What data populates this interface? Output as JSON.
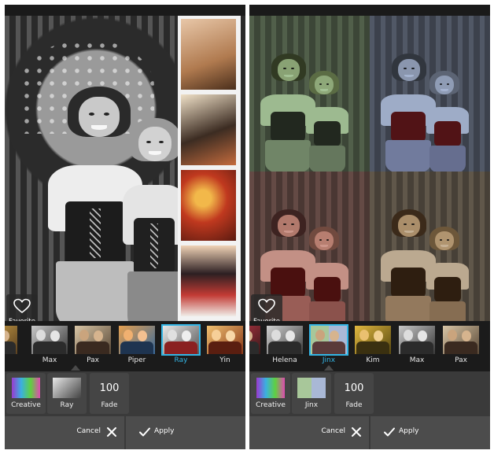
{
  "left": {
    "filters": [
      {
        "label": "m",
        "selected": false
      },
      {
        "label": "Max",
        "selected": false
      },
      {
        "label": "Pax",
        "selected": false
      },
      {
        "label": "Piper",
        "selected": false
      },
      {
        "label": "Ray",
        "selected": true
      },
      {
        "label": "Yin",
        "selected": false
      }
    ],
    "favorite_label": "Favorite",
    "options": {
      "creative_label": "Creative",
      "current_filter_label": "Ray",
      "fade_value": "100",
      "fade_label": "Fade"
    },
    "actions": {
      "cancel_label": "Cancel",
      "apply_label": "Apply"
    }
  },
  "right": {
    "filters": [
      {
        "label": "",
        "selected": false
      },
      {
        "label": "Helena",
        "selected": false
      },
      {
        "label": "Jinx",
        "selected": true
      },
      {
        "label": "Kim",
        "selected": false
      },
      {
        "label": "Max",
        "selected": false
      },
      {
        "label": "Pax",
        "selected": false
      }
    ],
    "favorite_label": "Favorite",
    "options": {
      "creative_label": "Creative",
      "current_filter_label": "Jinx",
      "fade_value": "100",
      "fade_label": "Fade"
    },
    "actions": {
      "cancel_label": "Cancel",
      "apply_label": "Apply"
    }
  },
  "colors": {
    "accent": "#33b5e5",
    "tile_green": "#a8c79a",
    "tile_blue": "#a9b8d6",
    "tile_red": "#d19a8f",
    "tile_sepia": "#c9b59a"
  },
  "icons": [
    "heart-icon",
    "close-icon",
    "check-icon"
  ]
}
